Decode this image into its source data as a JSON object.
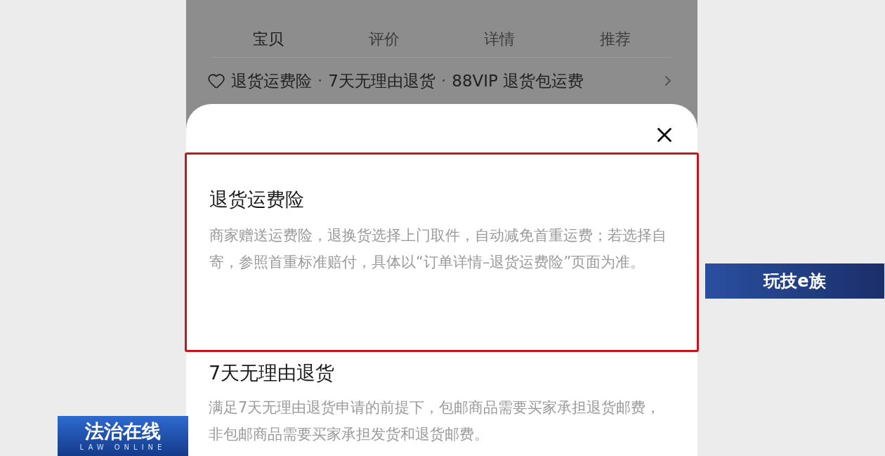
{
  "tabs": [
    {
      "label": "宝贝",
      "selected": true
    },
    {
      "label": "评价",
      "selected": false
    },
    {
      "label": "详情",
      "selected": false
    },
    {
      "label": "推荐",
      "selected": false
    }
  ],
  "services": {
    "items": [
      "退货运费险",
      "7天无理由退货",
      "88VIP 退货包运费"
    ],
    "separator": "·"
  },
  "sheet": {
    "sections": [
      {
        "title": "退货运费险",
        "body": "商家赠送运费险，退换货选择上门取件，自动减免首重运费；若选择自寄，参照首重标准赔付，具体以“订单详情–退货运费险”页面为准。",
        "highlighted": true
      },
      {
        "title": "7天无理由退货",
        "body": "满足7天无理由退货申请的前提下，包邮商品需要买家承担退货邮费，非包邮商品需要买家承担发货和退货邮费。",
        "highlighted": false
      }
    ]
  },
  "overlays": {
    "segment_badge": "玩技e族",
    "program_badge": {
      "title": "法治在线",
      "subtitle": "LAW ONLINE"
    }
  }
}
